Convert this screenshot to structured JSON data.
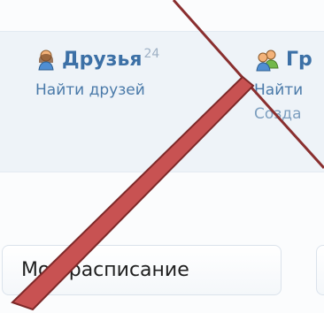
{
  "friends": {
    "title": "Друзья",
    "count": "24",
    "link": "Найти друзей",
    "icon": "user-icon"
  },
  "groups": {
    "title": "Гр",
    "link_1": "Найти",
    "link_2": "Созда",
    "icon": "group-icon"
  },
  "schedule": {
    "label": "Мой расписание"
  },
  "colors": {
    "link": "#3c70a6",
    "panel": "#eef3f8",
    "annotation": "#b94949"
  }
}
